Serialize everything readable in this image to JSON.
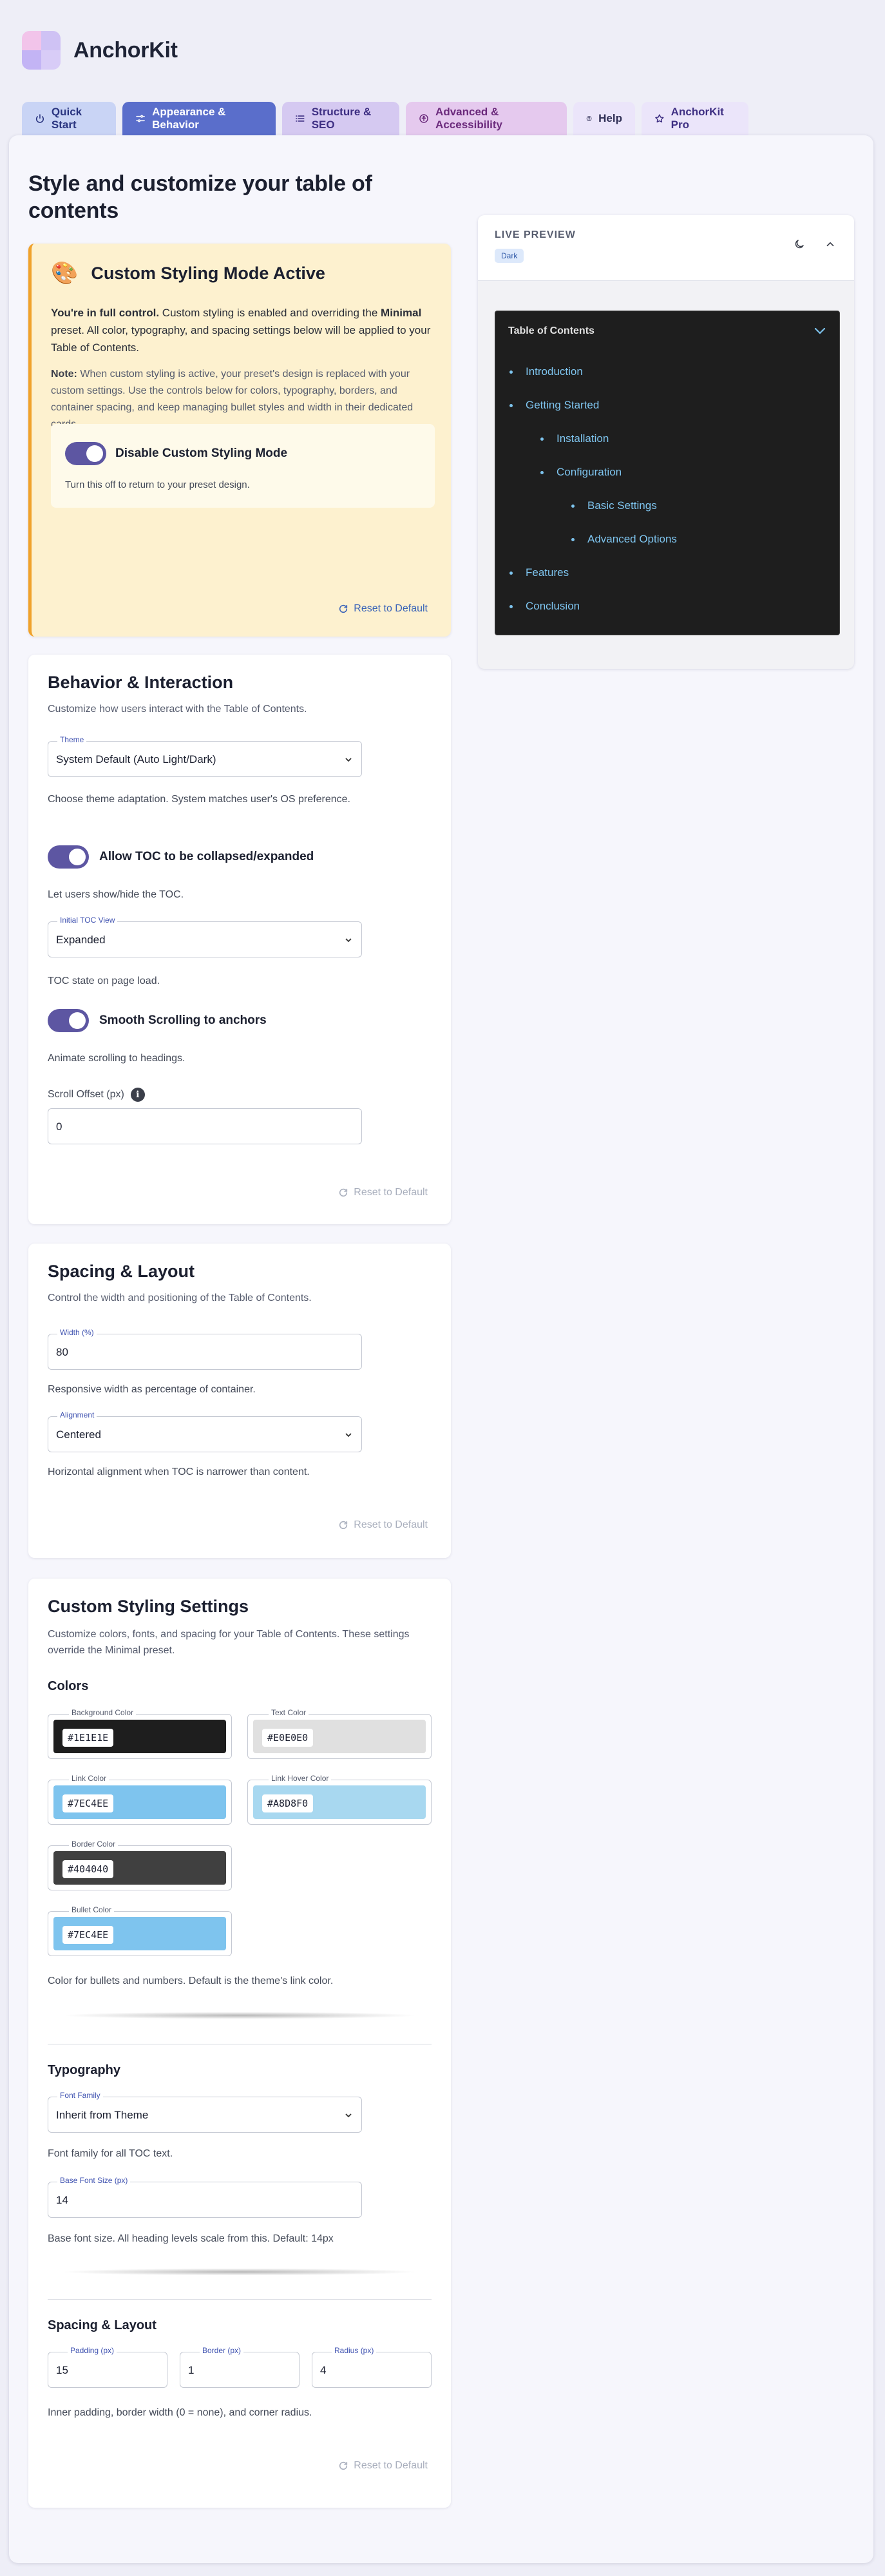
{
  "app": {
    "brand": "AnchorKit"
  },
  "tabs": [
    {
      "label": "Quick Start",
      "icon": "power-icon"
    },
    {
      "label": "Appearance & Behavior",
      "icon": "sliders-icon"
    },
    {
      "label": "Structure & SEO",
      "icon": "list-icon"
    },
    {
      "label": "Advanced & Accessibility",
      "icon": "accessibility-icon"
    },
    {
      "label": "Help",
      "icon": "help-icon"
    },
    {
      "label": "AnchorKit Pro",
      "icon": "star-icon"
    }
  ],
  "page": {
    "title": "Style and customize your table of contents"
  },
  "custom_mode": {
    "icon": "palette-icon",
    "title": "Custom Styling Mode Active",
    "p1_strong": "You're in full control.",
    "p1_a": " Custom styling is enabled and overriding the ",
    "p1_preset": "Minimal",
    "p1_b": " preset. All color, typography, and spacing settings below will be applied to your Table of Contents.",
    "p2_strong": "Note:",
    "p2_text": " When custom styling is active, your preset's design is replaced with your custom settings. Use the controls below for colors, typography, borders, and container spacing, and keep managing bullet styles and width in their dedicated cards.",
    "toggle_label": "Disable Custom Styling Mode",
    "toggle_hint": "Turn this off to return to your preset design.",
    "reset": "Reset to Default"
  },
  "behavior": {
    "title": "Behavior & Interaction",
    "desc": "Customize how users interact with the Table of Contents.",
    "theme_label": "Theme",
    "theme_value": "System Default (Auto Light/Dark)",
    "theme_help": "Choose theme adaptation. System matches user's OS preference.",
    "collapse_label": "Allow TOC to be collapsed/expanded",
    "collapse_help": "Let users show/hide the TOC.",
    "initial_label": "Initial TOC View",
    "initial_value": "Expanded",
    "initial_help": "TOC state on page load.",
    "smooth_label": "Smooth Scrolling to anchors",
    "smooth_help": "Animate scrolling to headings.",
    "offset_label": "Scroll Offset (px)",
    "offset_value": "0",
    "reset": "Reset to Default"
  },
  "spacing": {
    "title": "Spacing & Layout",
    "desc": "Control the width and positioning of the Table of Contents.",
    "width_label": "Width (%)",
    "width_value": "80",
    "width_help": "Responsive width as percentage of container.",
    "align_label": "Alignment",
    "align_value": "Centered",
    "align_help": "Horizontal alignment when TOC is narrower than content.",
    "reset": "Reset to Default"
  },
  "custom_settings": {
    "title": "Custom Styling Settings",
    "desc": "Customize colors, fonts, and spacing for your Table of Contents. These settings override the Minimal preset.",
    "colors_heading": "Colors",
    "colors": [
      {
        "label": "Background Color",
        "hex": "#1E1E1E",
        "color": "#1e1e1e"
      },
      {
        "label": "Text Color",
        "hex": "#E0E0E0",
        "color": "#e0e0e0"
      },
      {
        "label": "Link Color",
        "hex": "#7EC4EE",
        "color": "#7ec4ee"
      },
      {
        "label": "Link Hover Color",
        "hex": "#A8D8F0",
        "color": "#a8d8f0"
      },
      {
        "label": "Border Color",
        "hex": "#404040",
        "color": "#404040"
      },
      {
        "label": "Bullet Color",
        "hex": "#7EC4EE",
        "color": "#7ec4ee"
      }
    ],
    "bullet_help": "Color for bullets and numbers. Default is the theme's link color.",
    "typography_heading": "Typography",
    "font_family_label": "Font Family",
    "font_family_value": "Inherit from Theme",
    "font_family_help": "Font family for all TOC text.",
    "font_size_label": "Base Font Size (px)",
    "font_size_value": "14",
    "font_size_help": "Base font size. All heading levels scale from this. Default: 14px",
    "spacing_heading": "Spacing & Layout",
    "padding_label": "Padding (px)",
    "padding_value": "15",
    "border_label": "Border (px)",
    "border_value": "1",
    "radius_label": "Radius (px)",
    "radius_value": "4",
    "spacing_help": "Inner padding, border width (0 = none), and corner radius.",
    "reset": "Reset to Default"
  },
  "preview": {
    "title": "LIVE PREVIEW",
    "badge": "Dark",
    "toc_title": "Table of Contents",
    "items": [
      {
        "label": "Introduction",
        "level": 1
      },
      {
        "label": "Getting Started",
        "level": 1
      },
      {
        "label": "Installation",
        "level": 2
      },
      {
        "label": "Configuration",
        "level": 2
      },
      {
        "label": "Basic Settings",
        "level": 3
      },
      {
        "label": "Advanced Options",
        "level": 3
      },
      {
        "label": "Features",
        "level": 1
      },
      {
        "label": "Conclusion",
        "level": 1
      }
    ]
  }
}
